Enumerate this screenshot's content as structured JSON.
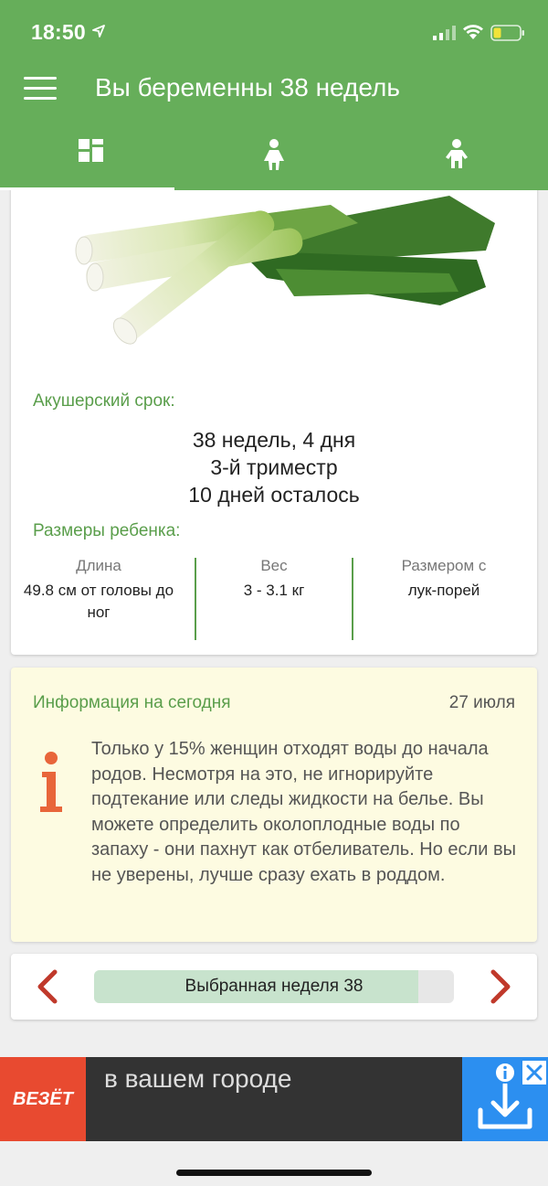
{
  "status_bar": {
    "time": "18:50"
  },
  "app_bar": {
    "title": "Вы беременны 38 недель"
  },
  "tabs": [
    {
      "icon": "dashboard-icon",
      "active": true
    },
    {
      "icon": "woman-icon",
      "active": false
    },
    {
      "icon": "child-icon",
      "active": false
    }
  ],
  "summary": {
    "term_label": "Акушерский срок:",
    "term_lines": [
      "38 недель, 4 дня",
      "3-й триместр",
      "10 дней осталось"
    ],
    "size_label": "Размеры ребенка:",
    "metrics": [
      {
        "title": "Длина",
        "value": "49.8 см от головы до ног"
      },
      {
        "title": "Вес",
        "value": "3 - 3.1 кг"
      },
      {
        "title": "Размером с",
        "value": "лук-порей"
      }
    ]
  },
  "info": {
    "title": "Информация на сегодня",
    "date": "27 июля",
    "text": "Только у 15% женщин отходят воды до начала родов. Несмотря на это, не игнорируйте подтекание или следы жидкости на белье. Вы можете определить околоплодные воды по запаху - они пахнут как отбеливатель. Но если вы не уверены, лучше сразу ехать в роддом."
  },
  "week_nav": {
    "label": "Выбранная неделя 38",
    "progress": 0.9
  },
  "ad": {
    "brand": "ВЕЗЁТ",
    "text": "в вашем городе"
  },
  "colors": {
    "primary": "#66ae5a",
    "accent_green": "#5a9e4b",
    "info_bg": "#fdfbe1",
    "nav_arrow": "#c0392b",
    "ad_brand": "#e84a30",
    "ad_download": "#2c8ff0"
  }
}
